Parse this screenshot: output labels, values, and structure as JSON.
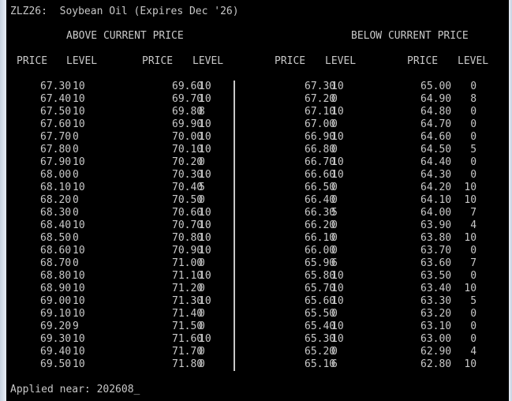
{
  "title_line": "ZLZ26:  Soybean Oil (Expires Dec '26)",
  "sections": {
    "above": "ABOVE CURRENT PRICE",
    "below": "BELOW CURRENT PRICE"
  },
  "headers": {
    "price": "PRICE",
    "level": "LEVEL"
  },
  "footer": "Applied near: 202608",
  "cursor": "_",
  "rows": [
    [
      "67.30",
      "10",
      "69.60",
      "10",
      "67.30",
      "10",
      "65.00",
      "0"
    ],
    [
      "67.40",
      "10",
      "69.70",
      "10",
      "67.20",
      "0",
      "64.90",
      "8"
    ],
    [
      "67.50",
      "10",
      "69.80",
      "8",
      "67.10",
      "10",
      "64.80",
      "0"
    ],
    [
      "67.60",
      "10",
      "69.90",
      "10",
      "67.00",
      "0",
      "64.70",
      "0"
    ],
    [
      "67.70",
      "0",
      "70.00",
      "10",
      "66.90",
      "10",
      "64.60",
      "0"
    ],
    [
      "67.80",
      "0",
      "70.10",
      "10",
      "66.80",
      "0",
      "64.50",
      "5"
    ],
    [
      "67.90",
      "10",
      "70.20",
      "0",
      "66.70",
      "10",
      "64.40",
      "0"
    ],
    [
      "68.00",
      "0",
      "70.30",
      "10",
      "66.60",
      "10",
      "64.30",
      "0"
    ],
    [
      "68.10",
      "10",
      "70.40",
      "5",
      "66.50",
      "0",
      "64.20",
      "10"
    ],
    [
      "68.20",
      "0",
      "70.50",
      "0",
      "66.40",
      "0",
      "64.10",
      "10"
    ],
    [
      "68.30",
      "0",
      "70.60",
      "10",
      "66.30",
      "5",
      "64.00",
      "7"
    ],
    [
      "68.40",
      "10",
      "70.70",
      "10",
      "66.20",
      "0",
      "63.90",
      "4"
    ],
    [
      "68.50",
      "0",
      "70.80",
      "10",
      "66.10",
      "0",
      "63.80",
      "10"
    ],
    [
      "68.60",
      "10",
      "70.90",
      "10",
      "66.00",
      "0",
      "63.70",
      "0"
    ],
    [
      "68.70",
      "0",
      "71.00",
      "0",
      "65.90",
      "6",
      "63.60",
      "7"
    ],
    [
      "68.80",
      "10",
      "71.10",
      "10",
      "65.80",
      "10",
      "63.50",
      "0"
    ],
    [
      "68.90",
      "10",
      "71.20",
      "0",
      "65.70",
      "10",
      "63.40",
      "10"
    ],
    [
      "69.00",
      "10",
      "71.30",
      "10",
      "65.60",
      "10",
      "63.30",
      "5"
    ],
    [
      "69.10",
      "10",
      "71.40",
      "0",
      "65.50",
      "0",
      "63.20",
      "0"
    ],
    [
      "69.20",
      "9",
      "71.50",
      "0",
      "65.40",
      "10",
      "63.10",
      "0"
    ],
    [
      "69.30",
      "10",
      "71.60",
      "10",
      "65.30",
      "10",
      "63.00",
      "0"
    ],
    [
      "69.40",
      "10",
      "71.70",
      "0",
      "65.20",
      "0",
      "62.90",
      "4"
    ],
    [
      "69.50",
      "10",
      "71.80",
      "0",
      "65.10",
      "6",
      "62.80",
      "10"
    ]
  ]
}
